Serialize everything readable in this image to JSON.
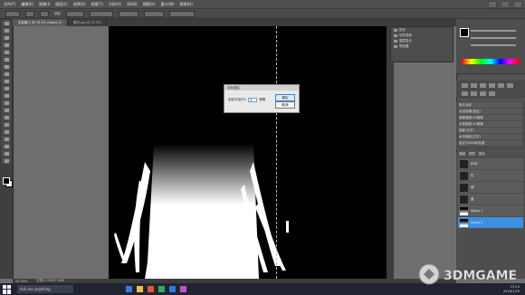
{
  "menubar": {
    "items": [
      "文件(F)",
      "编辑(E)",
      "图像(I)",
      "图层(L)",
      "选择(S)",
      "滤镜(T)",
      "分析(A)",
      "3D(D)",
      "视图(V)",
      "窗口(W)",
      "帮助(H)"
    ]
  },
  "options": {
    "sample_value": "羽化"
  },
  "tabs": [
    {
      "label": "未标题-1 @ 33.3% (Alpha 2)",
      "active": true
    },
    {
      "label": "素材.jpg @ 33.3%"
    }
  ],
  "dialog": {
    "title": "羽化选区",
    "field_label": "羽化半径(R):",
    "field_value": "5",
    "unit": "像素",
    "ok_label": "确定",
    "cancel_label": "取消"
  },
  "mini_panel": {
    "items": [
      "历史",
      "动作选择",
      "图层复合",
      "导航器"
    ]
  },
  "actions_panel": {
    "items": [
      "默认动作",
      "淡出效果(选区)",
      "画框通道-50像素",
      "木质画框-50像素",
      "投影(文字)",
      "水中倒影(文字)",
      "自定义RGB到灰度",
      "熔化的铅块"
    ]
  },
  "layers_panel": {
    "tabs": [
      "通道",
      "图层",
      "路径"
    ],
    "layers": [
      {
        "name": "RGB",
        "selected": false
      },
      {
        "name": "红",
        "selected": false
      },
      {
        "name": "绿",
        "selected": false
      },
      {
        "name": "蓝",
        "selected": false
      },
      {
        "name": "Alpha 1",
        "selected": false
      },
      {
        "name": "Alpha 2",
        "selected": true
      }
    ]
  },
  "statusbar": {
    "zoom": "33.33%",
    "doc": "文档:2.20M/7.00M"
  },
  "taskbar": {
    "search_placeholder": "Ask me anything",
    "time": "13:14",
    "date": "2016/1/29"
  },
  "watermark": {
    "text": "3DMGAME"
  }
}
